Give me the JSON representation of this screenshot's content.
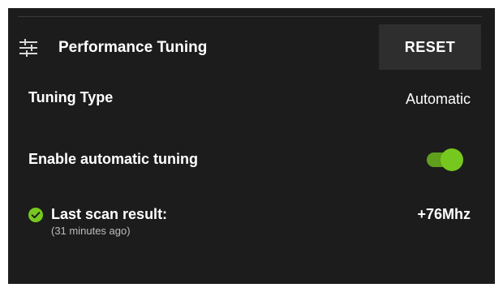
{
  "header": {
    "icon": "sliders-icon",
    "title": "Performance Tuning",
    "reset_label": "RESET"
  },
  "tuning_type": {
    "label": "Tuning Type",
    "value": "Automatic"
  },
  "auto_tuning": {
    "label": "Enable automatic tuning",
    "enabled": true,
    "toggle_color": "#76c81f"
  },
  "last_scan": {
    "icon": "check-circle-icon",
    "label": "Last scan result:",
    "time_ago": "(31 minutes ago)",
    "value": "+76Mhz"
  },
  "colors": {
    "background": "#1c1c1c",
    "accent": "#76c81f",
    "button_bg": "#2e2e2e"
  }
}
